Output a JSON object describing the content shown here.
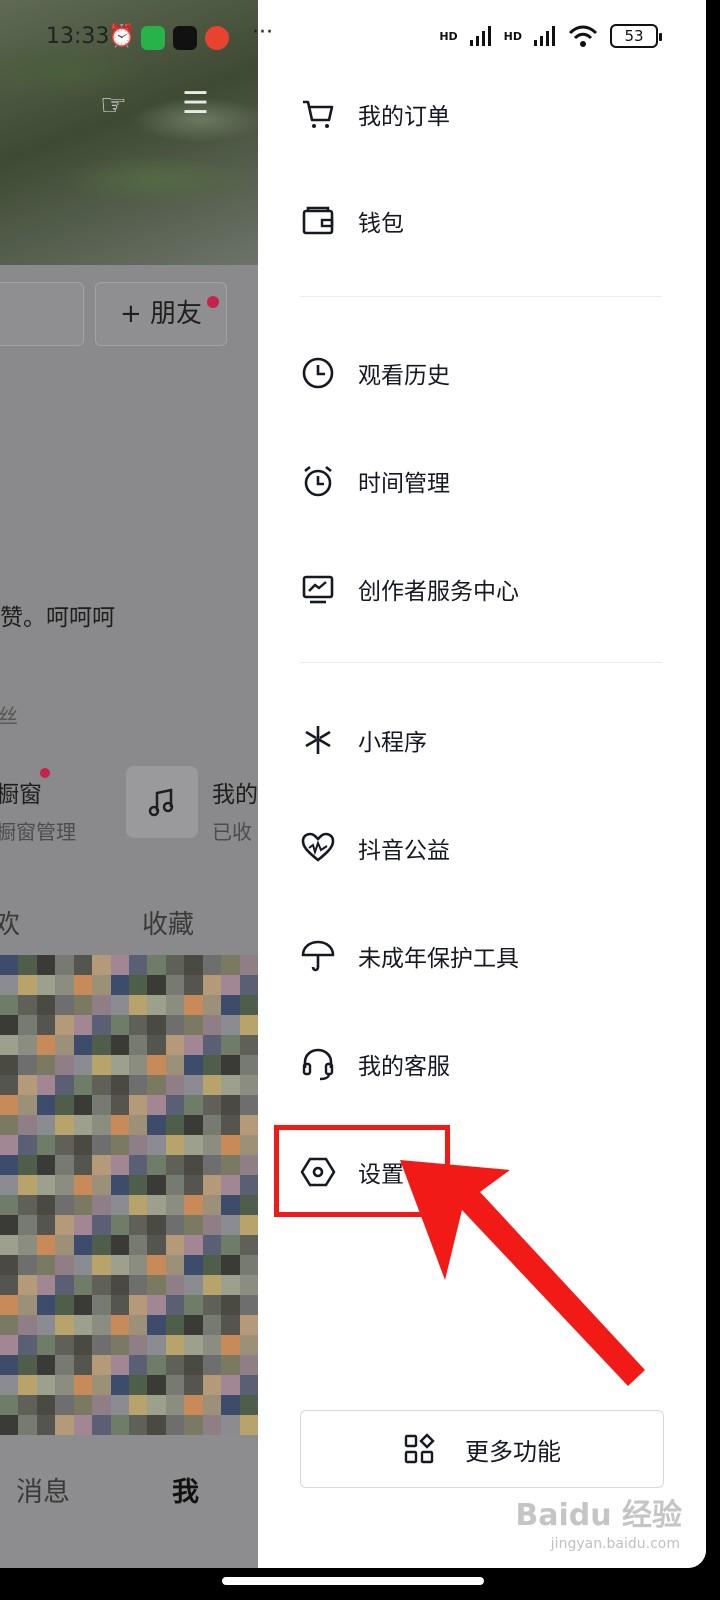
{
  "status_bar": {
    "time": "13:33",
    "network_1": "HD",
    "network_2": "HD",
    "battery": "53"
  },
  "profile_bg": {
    "add_friend": "+ 朋友",
    "bio": "赞。呵呵呵",
    "fans_fragment": "丝",
    "showcase_fragment": "橱窗",
    "showcase_sub": "橱窗管理",
    "music_fragment": "我的",
    "music_sub": "已收",
    "tab_like_fragment": "欢",
    "tab_collect": "收藏",
    "nav_messages": "消息",
    "nav_me": "我"
  },
  "drawer": {
    "items": [
      {
        "label": "我的订单",
        "icon": "cart-icon"
      },
      {
        "label": "钱包",
        "icon": "wallet-icon"
      },
      {
        "label": "观看历史",
        "icon": "clock-icon"
      },
      {
        "label": "时间管理",
        "icon": "alarm-icon"
      },
      {
        "label": "创作者服务中心",
        "icon": "creator-chart-icon"
      },
      {
        "label": "小程序",
        "icon": "mini-program-icon"
      },
      {
        "label": "抖音公益",
        "icon": "charity-heart-icon"
      },
      {
        "label": "未成年保护工具",
        "icon": "umbrella-icon"
      },
      {
        "label": "我的客服",
        "icon": "headset-icon"
      },
      {
        "label": "设置",
        "icon": "settings-hex-icon"
      }
    ],
    "more_features": "更多功能"
  },
  "watermark": {
    "brand": "Baidu 经验",
    "url": "jingyan.baidu.com"
  },
  "colors": {
    "annotation_red": "#f21a17",
    "badge_red": "#c7224b",
    "text_primary": "#161823"
  }
}
